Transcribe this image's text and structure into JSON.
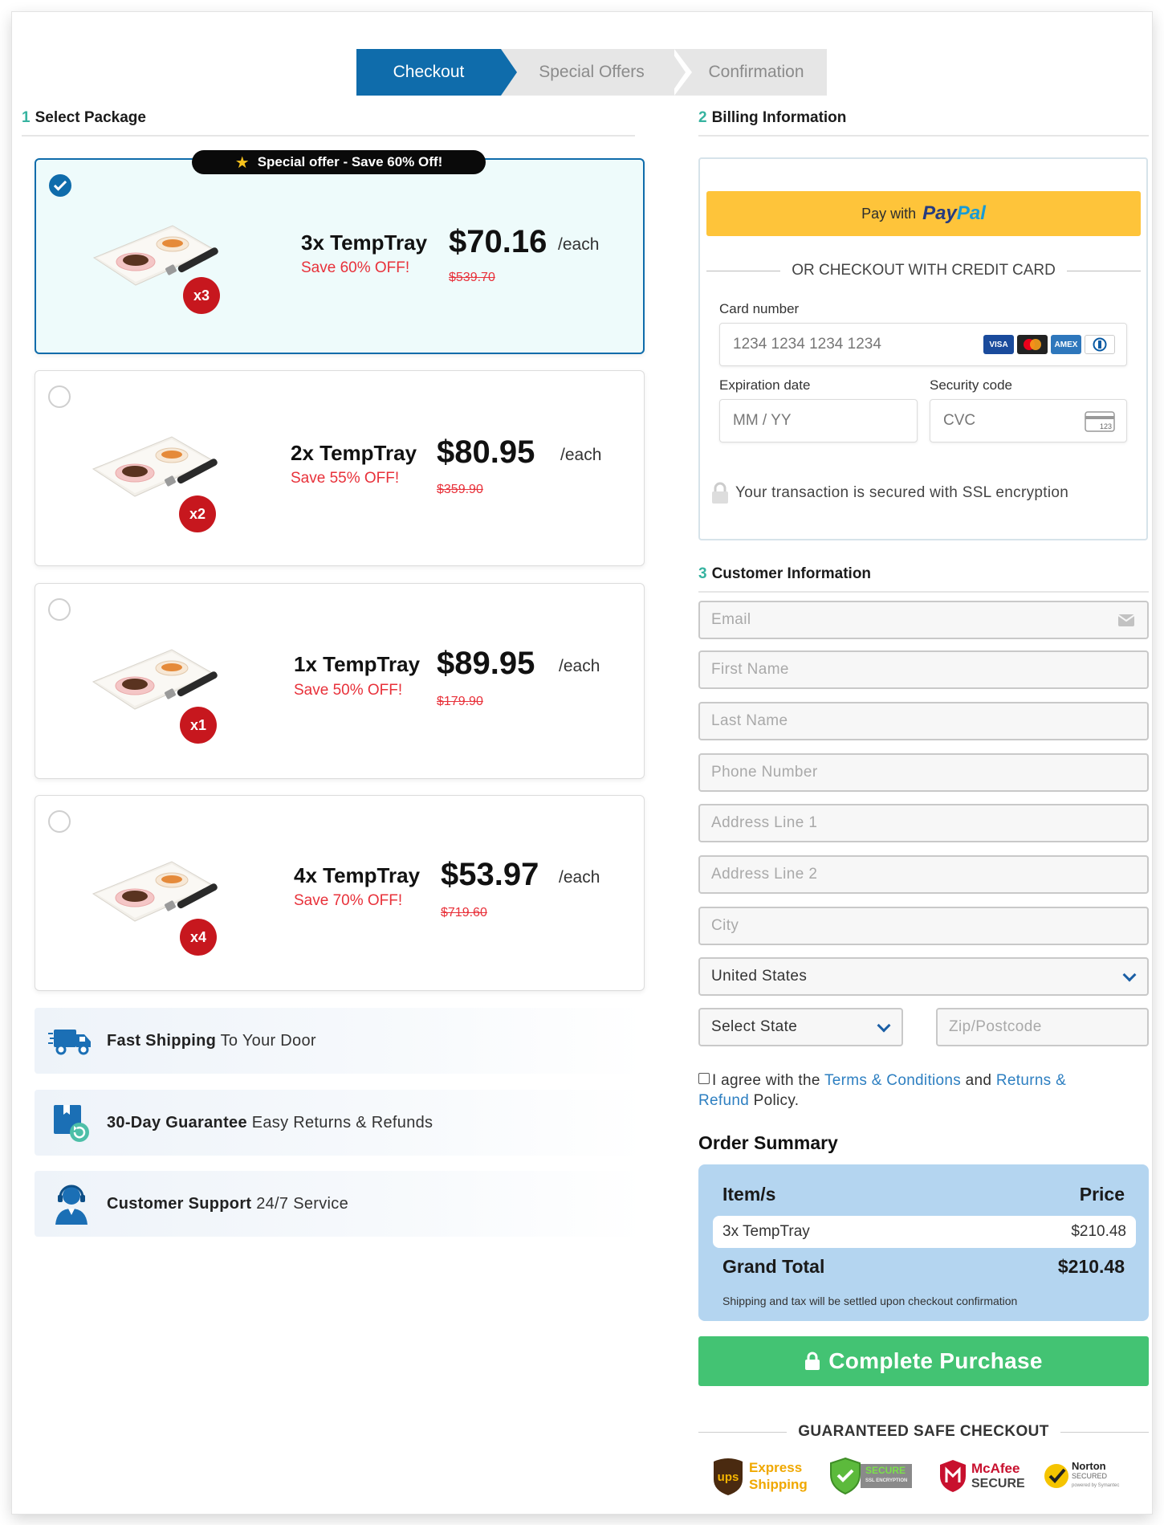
{
  "steps": [
    "Checkout",
    "Special Offers",
    "Confirmation"
  ],
  "select_package": {
    "num": "1",
    "title": "Select Package"
  },
  "offer_pill": "Special offer - Save 60% Off!",
  "packages": [
    {
      "name": "3x TempTray",
      "save": "Save 60% OFF!",
      "price": "$70.16",
      "each": "/each",
      "old": "$539.70",
      "badge": "x3",
      "selected": true
    },
    {
      "name": "2x TempTray",
      "save": "Save 55% OFF!",
      "price": "$80.95",
      "each": "/each",
      "old": "$359.90",
      "badge": "x2",
      "selected": false
    },
    {
      "name": "1x TempTray",
      "save": "Save 50% OFF!",
      "price": "$89.95",
      "each": "/each",
      "old": "$179.90",
      "badge": "x1",
      "selected": false
    },
    {
      "name": "4x TempTray",
      "save": "Save 70% OFF!",
      "price": "$53.97",
      "each": "/each",
      "old": "$719.60",
      "badge": "x4",
      "selected": false
    }
  ],
  "features": [
    {
      "bold": "Fast Shipping",
      "rest": " To Your Door",
      "icon": "truck-icon"
    },
    {
      "bold": "30-Day Guarantee",
      "rest": " Easy Returns & Refunds",
      "icon": "return-box-icon"
    },
    {
      "bold": "Customer Support",
      "rest": " 24/7 Service",
      "icon": "support-agent-icon"
    }
  ],
  "billing": {
    "num": "2",
    "title": "Billing Information",
    "paypal_prefix": "Pay with",
    "paypal_a": "Pay",
    "paypal_b": "Pal",
    "or_text": "OR CHECKOUT WITH CREDIT CARD",
    "card_label": "Card number",
    "card_placeholder": "1234 1234 1234 1234",
    "exp_label": "Expiration date",
    "exp_placeholder": "MM / YY",
    "cvc_label": "Security code",
    "cvc_placeholder": "CVC",
    "cvc_icon_text": "123",
    "card_brands": [
      "VISA",
      "mastercard",
      "AMEX",
      "Diners"
    ],
    "ssl_text": "Your transaction is secured with SSL encryption"
  },
  "customer": {
    "num": "3",
    "title": "Customer Information",
    "email": "Email",
    "first_name": "First Name",
    "last_name": "Last Name",
    "phone": "Phone Number",
    "address1": "Address Line 1",
    "address2": "Address Line 2",
    "city": "City",
    "country": "United States",
    "state": "Select State",
    "zip": "Zip/Postcode"
  },
  "agree": {
    "pre": "I agree with the ",
    "terms": "Terms & Conditions",
    "mid": " and ",
    "returns": "Returns & Refund",
    "post": " Policy."
  },
  "order_summary": {
    "title": "Order Summary",
    "col_item": "Item/s",
    "col_price": "Price",
    "item_name": "3x TempTray",
    "item_price": "$210.48",
    "grand_label": "Grand Total",
    "grand_value": "$210.48",
    "note": "Shipping and tax will be settled upon checkout confirmation"
  },
  "purchase_button": "Complete Purchase",
  "safe_checkout": "GUARANTEED SAFE CHECKOUT",
  "trust_badges": {
    "ups": "ups",
    "ups_text1": "Express",
    "ups_text2": "Shipping",
    "secure": "SECURE",
    "secure_sub": "SSL ENCRYPTION",
    "mcafee1": "McAfee",
    "mcafee2": "SECURE",
    "norton1": "Norton",
    "norton2": "SECURED",
    "norton3": "powered by Symantec"
  },
  "colors": {
    "primary": "#0f6cab",
    "accent_red": "#e8313a",
    "green": "#43c373",
    "paypal": "#fec43a"
  }
}
